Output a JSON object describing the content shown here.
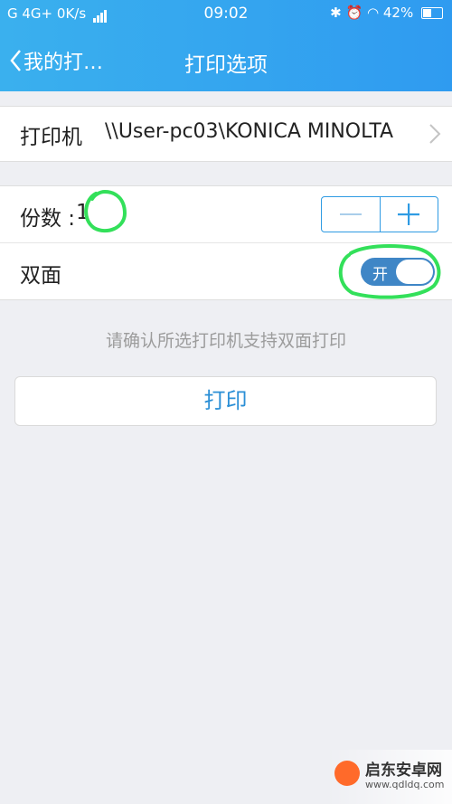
{
  "status_bar": {
    "left": "G 4G+ 0K/s",
    "time": "09:02",
    "battery": "42%"
  },
  "nav": {
    "back_label": "我的打…",
    "title": "打印选项"
  },
  "printer": {
    "label": "打印机",
    "name": "\\\\User-pc03\\KONICA MINOLTA"
  },
  "copies": {
    "label": "份数 :",
    "value": "1"
  },
  "duplex": {
    "label": "双面",
    "toggle_text": "开"
  },
  "hint": "请确认所选打印机支持双面打印",
  "print_button": "打印",
  "watermark": {
    "name": "启东安卓网",
    "url": "www.qdldq.com"
  }
}
